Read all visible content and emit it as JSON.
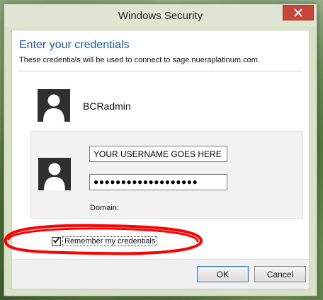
{
  "window": {
    "title": "Windows Security"
  },
  "dialog": {
    "heading": "Enter your credentials",
    "subheading": "These credentials will be used to connect to sage.nueraplatinum.com."
  },
  "saved_user": {
    "name": "BCRadmin",
    "avatar_icon": "user-silhouette-icon"
  },
  "credentials": {
    "avatar_icon": "user-silhouette-icon",
    "username_value": "YOUR USERNAME GOES HERE",
    "password_value": "●●●●●●●●●●●●●●●●●●●",
    "domain_label": "Domain:"
  },
  "remember": {
    "label": "Remember my credentials",
    "checked": true
  },
  "buttons": {
    "ok_label": "OK",
    "cancel_label": "Cancel"
  },
  "colors": {
    "heading_blue": "#1f5fa6",
    "close_red": "#c7463a",
    "annotation_red": "#ff0000"
  }
}
